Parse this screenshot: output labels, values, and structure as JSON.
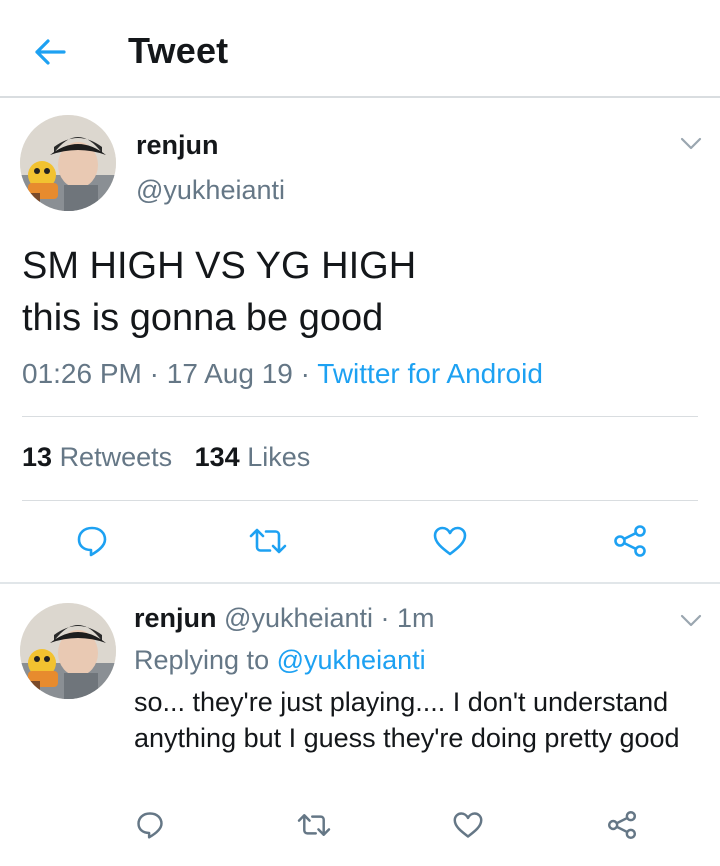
{
  "header": {
    "back_icon": "arrow-left-icon",
    "title": "Tweet",
    "accent": "#1da1f2"
  },
  "tweet": {
    "author_name": "renjun",
    "author_handle": "@yukheianti",
    "text_lines": [
      "SM HIGH VS YG HIGH",
      "this is gonna be good"
    ],
    "time": "01:26 PM",
    "date": "17 Aug 19",
    "source": "Twitter for Android",
    "retweets_count": "13",
    "retweets_label": "Retweets",
    "likes_count": "134",
    "likes_label": "Likes",
    "actions": [
      "reply-icon",
      "retweet-icon",
      "like-icon",
      "share-icon"
    ]
  },
  "reply": {
    "author_name": "renjun",
    "author_handle": "@yukheianti",
    "age": "1m",
    "replying_prefix": "Replying to",
    "replying_to": "@yukheianti",
    "text": "so... they're just playing.... I don't understand anything but I guess they're doing pretty good",
    "actions": [
      "reply-icon",
      "retweet-icon",
      "like-icon",
      "share-icon"
    ]
  },
  "colors": {
    "text": "#14171a",
    "secondary": "#657786",
    "link": "#1da1f2",
    "divider": "#d9dde0"
  }
}
